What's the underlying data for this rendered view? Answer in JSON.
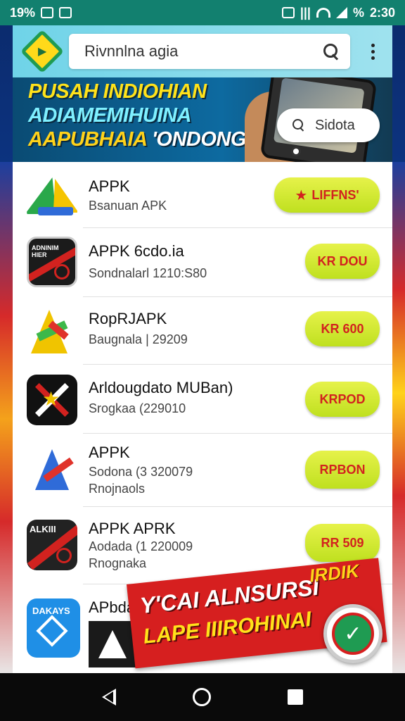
{
  "status_bar": {
    "left_text": "19%",
    "battery": "%",
    "time": "2:30"
  },
  "app_bar": {
    "search_text": "Rivnnlna agia"
  },
  "banner": {
    "line1": "PUSAH INDIOHIAN",
    "line2": "ADIAMEMIHUINA",
    "line3_a": "AAPUBHAIA",
    "line3_b": "'ONDONGAAS",
    "search_text": "Sidota"
  },
  "apps": [
    {
      "name": "APPK",
      "meta": "Bsanuan APK",
      "meta2": "",
      "button": "LIFFNS'",
      "button_style": "featured",
      "icon": "a-gradient-icon"
    },
    {
      "name": "APPK 6cdo.ia",
      "meta": "Sondnalarl 1210:S80",
      "meta2": "",
      "button": "KR DOU",
      "button_style": "normal",
      "icon": "dark-stripe-icon"
    },
    {
      "name": "RopRJAPK",
      "meta": "Baugnala  |  29209",
      "meta2": "",
      "button": "KR 600",
      "button_style": "normal",
      "icon": "a-color-icon"
    },
    {
      "name": "Arldougdato MUBan)",
      "meta": "Srogkaa (229010",
      "meta2": "",
      "button": "KRPOD",
      "button_style": "normal",
      "icon": "x-star-icon"
    },
    {
      "name": "APPK",
      "meta": "Sodona (3 320079",
      "meta2": "Rnojnaols",
      "button": "RPBON",
      "button_style": "normal",
      "icon": "a-blue-icon"
    },
    {
      "name": "APPK APRK",
      "meta": "Aodada (1 220009",
      "meta2": "Rnognaka",
      "button": "RR 509",
      "button_style": "normal",
      "icon": "dark-ring-icon"
    },
    {
      "name": "APbda",
      "meta": "",
      "meta2": "",
      "button": "",
      "button_style": "hidden",
      "icon": "blue-diamond-icon"
    }
  ],
  "icon_labels": {
    "dark1": "ADNINIM HIER",
    "dark2": "ALKIII",
    "blue": "DAKAYS"
  },
  "promo": {
    "line1": "Y'CAI ALNSURSI",
    "line2": "LAPE IIIROHINAI",
    "tag": "IRDIK",
    "badge": "✓"
  },
  "colors": {
    "status_bg": "#12806f",
    "button_bg": "#d4ea30",
    "button_text": "#d2221f",
    "promo_bg": "#d61f1f"
  }
}
